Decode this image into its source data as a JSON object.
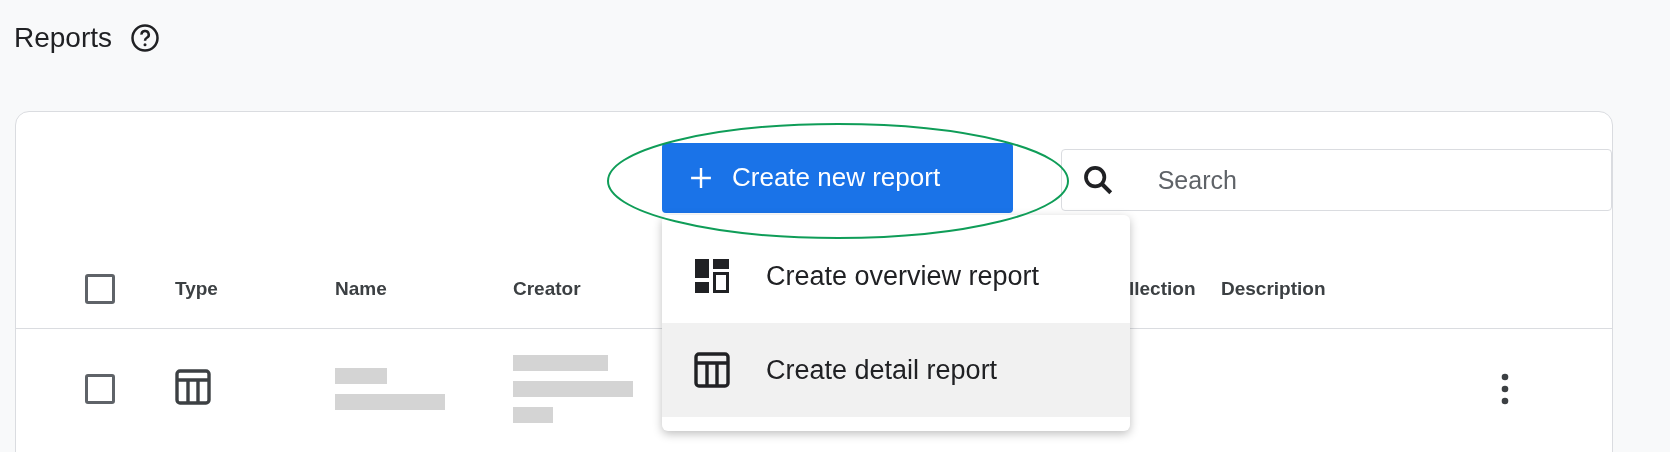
{
  "page": {
    "title": "Reports"
  },
  "toolbar": {
    "create_button": "Create new report",
    "search": {
      "placeholder": "Search"
    }
  },
  "menu": {
    "items": [
      {
        "kind": "overview",
        "label": "Create overview report",
        "selected": false
      },
      {
        "kind": "detail",
        "label": "Create detail report",
        "selected": true
      }
    ]
  },
  "table": {
    "select_all_checked": false,
    "columns": [
      "Type",
      "Name",
      "Creator",
      "llection",
      "Description"
    ],
    "rows": [
      {
        "checked": false,
        "kind": "detail"
      }
    ]
  }
}
